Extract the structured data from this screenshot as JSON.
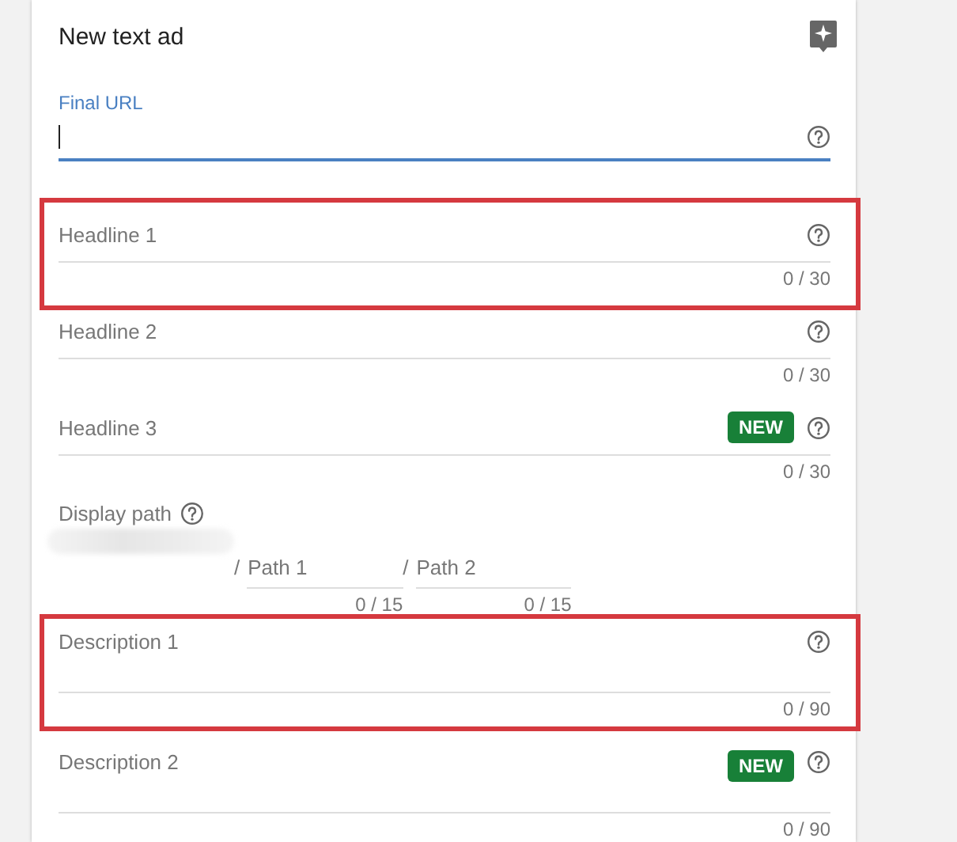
{
  "card": {
    "title": "New text ad"
  },
  "fields": [
    {
      "kind": "text",
      "label": "Final URL",
      "focused": true,
      "highlighted": false
    },
    {
      "kind": "text",
      "label": "Headline 1",
      "focused": false,
      "highlighted": true,
      "counter": "0 / 30"
    },
    {
      "kind": "text",
      "label": "Headline 2",
      "focused": false,
      "highlighted": false,
      "counter": "0 / 30"
    },
    {
      "kind": "text",
      "label": "Headline 3",
      "focused": false,
      "highlighted": false,
      "badge": "NEW",
      "counter": "0 / 30"
    },
    {
      "kind": "path",
      "label": "Display path",
      "paths": [
        {
          "separator": "/",
          "placeholder": "Path 1",
          "counter": "0 / 15"
        },
        {
          "separator": "/",
          "placeholder": "Path 2",
          "counter": "0 / 15"
        }
      ]
    },
    {
      "kind": "textarea",
      "label": "Description 1",
      "focused": false,
      "highlighted": true,
      "counter": "0 / 90"
    },
    {
      "kind": "textarea",
      "label": "Description 2",
      "focused": false,
      "highlighted": false,
      "badge": "NEW",
      "counter": "0 / 90"
    }
  ]
}
